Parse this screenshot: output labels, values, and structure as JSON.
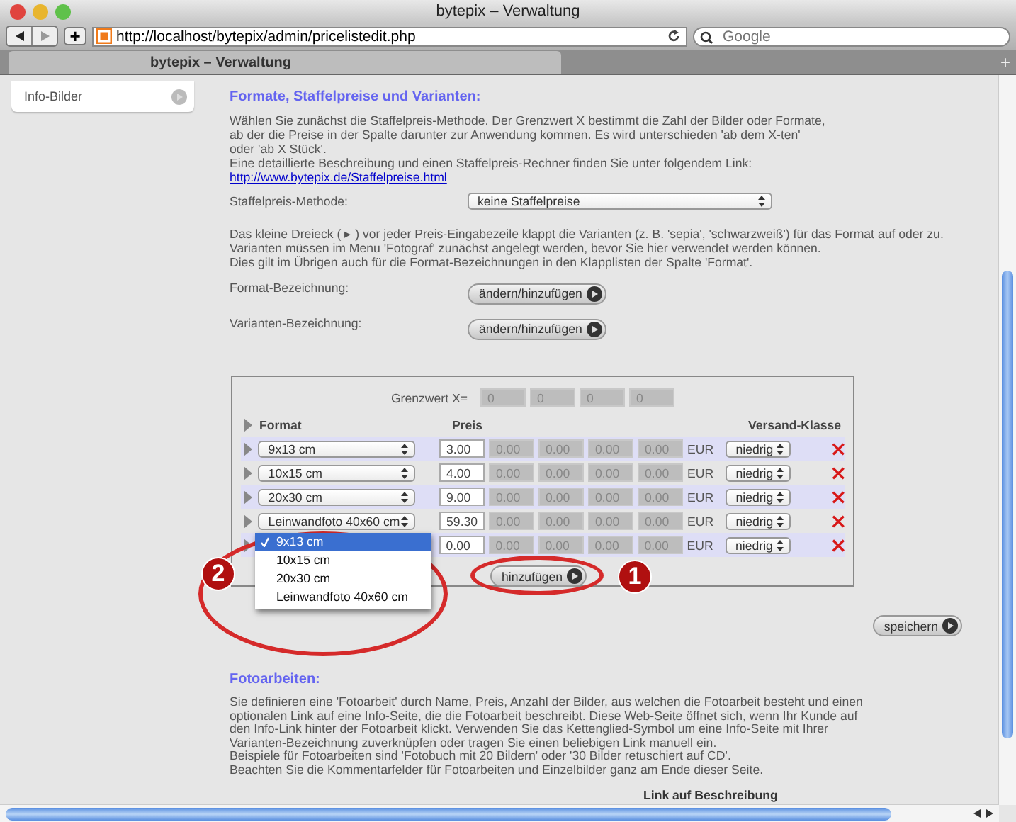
{
  "window": {
    "title": "bytepix – Verwaltung"
  },
  "toolbar": {
    "url": "http://localhost/bytepix/admin/pricelistedit.php",
    "search_placeholder": "Google",
    "new_tab_symbol": "+"
  },
  "tabs": [
    {
      "label": "bytepix – Verwaltung",
      "selected": true
    }
  ],
  "sidebar": {
    "items": [
      {
        "label": "Info-Bilder"
      }
    ]
  },
  "section": {
    "heading": "Formate, Staffelpreise und Varianten:",
    "intro_lines": [
      "Wählen Sie zunächst die Staffelpreis-Methode. Der Grenzwert X bestimmt die Zahl der Bilder oder Formate,",
      "ab der die Preise in der Spalte darunter zur Anwendung kommen. Es wird unterschieden 'ab dem X-ten'",
      "oder 'ab X Stück'.",
      "Eine detaillierte Beschreibung und einen Staffelpreis-Rechner finden Sie unter folgendem Link:"
    ],
    "link": "http://www.bytepix.de/Staffelpreise.html",
    "method_label": "Staffelpreis-Methode:",
    "method_value": "keine Staffelpreise",
    "info_lines": [
      "Das kleine Dreieck ( ▸ ) vor jeder Preis-Eingabezeile klappt die Varianten (z. B. 'sepia', 'schwarzweiß') für das Format auf oder zu.",
      "Varianten müssen im Menu 'Fotograf' zunächst angelegt werden, bevor Sie hier verwendet werden können.",
      "Dies gilt im Übrigen auch für die Format-Bezeichnungen in den Klapplisten der Spalte 'Format'."
    ],
    "settings": [
      {
        "label": "Format-Bezeichnung:",
        "button": "ändern/hinzufügen"
      },
      {
        "label": "Varianten-Bezeichnung:",
        "button": "ändern/hinzufügen"
      }
    ]
  },
  "price_table": {
    "threshold_label": "Grenzwert X=",
    "thresholds": [
      "0",
      "0",
      "0",
      "0"
    ],
    "columns": {
      "format": "Format",
      "price": "Preis",
      "shipping": "Versand-Klasse"
    },
    "rows": [
      {
        "format": "9x13 cm",
        "price": "3.00",
        "tiers": [
          "0.00",
          "0.00",
          "0.00",
          "0.00"
        ],
        "currency": "EUR",
        "shipping": "niedrig"
      },
      {
        "format": "10x15 cm",
        "price": "4.00",
        "tiers": [
          "0.00",
          "0.00",
          "0.00",
          "0.00"
        ],
        "currency": "EUR",
        "shipping": "niedrig"
      },
      {
        "format": "20x30 cm",
        "price": "9.00",
        "tiers": [
          "0.00",
          "0.00",
          "0.00",
          "0.00"
        ],
        "currency": "EUR",
        "shipping": "niedrig"
      },
      {
        "format": "Leinwandfoto 40x60 cm",
        "price": "59.30",
        "tiers": [
          "0.00",
          "0.00",
          "0.00",
          "0.00"
        ],
        "currency": "EUR",
        "shipping": "niedrig"
      },
      {
        "price": "0.00",
        "tiers": [
          "0.00",
          "0.00",
          "0.00",
          "0.00"
        ],
        "currency": "EUR",
        "shipping": "niedrig"
      }
    ],
    "add_button": "hinzufügen",
    "dropdown": [
      {
        "label": "9x13 cm",
        "selected": true
      },
      {
        "label": "10x15 cm",
        "selected": false
      },
      {
        "label": "20x30 cm",
        "selected": false
      },
      {
        "label": "Leinwandfoto 40x60 cm",
        "selected": false
      }
    ]
  },
  "save_button": "speichern",
  "annotations": [
    {
      "number": "2"
    },
    {
      "number": "1"
    }
  ],
  "photo_works": {
    "heading": "Fotoarbeiten:",
    "lines": [
      "Sie definieren eine 'Fotoarbeit' durch Name, Preis, Anzahl der Bilder, aus welchen die Fotoarbeit besteht und einen",
      "optionalen Link auf eine Info-Seite, die die Fotoarbeit beschreibt. Diese Web-Seite öffnet sich, wenn Ihr Kunde auf",
      "den Info-Link hinter der Fotoarbeit klickt. Verwenden Sie das Kettenglied-Symbol um eine Info-Seite mit Ihrer",
      "Varianten-Bezeichnung zuverknüpfen oder tragen Sie einen beliebigen Link manuell ein.",
      "Beispiele für Fotoarbeiten sind 'Fotobuch mit 20 Bildern' oder '30 Bilder retuschiert auf CD'.",
      "Beachten Sie die Kommentarfelder für Fotoarbeiten und Einzelbilder ganz am Ende dieser Seite."
    ],
    "column_header": "Link auf Beschreibung"
  }
}
